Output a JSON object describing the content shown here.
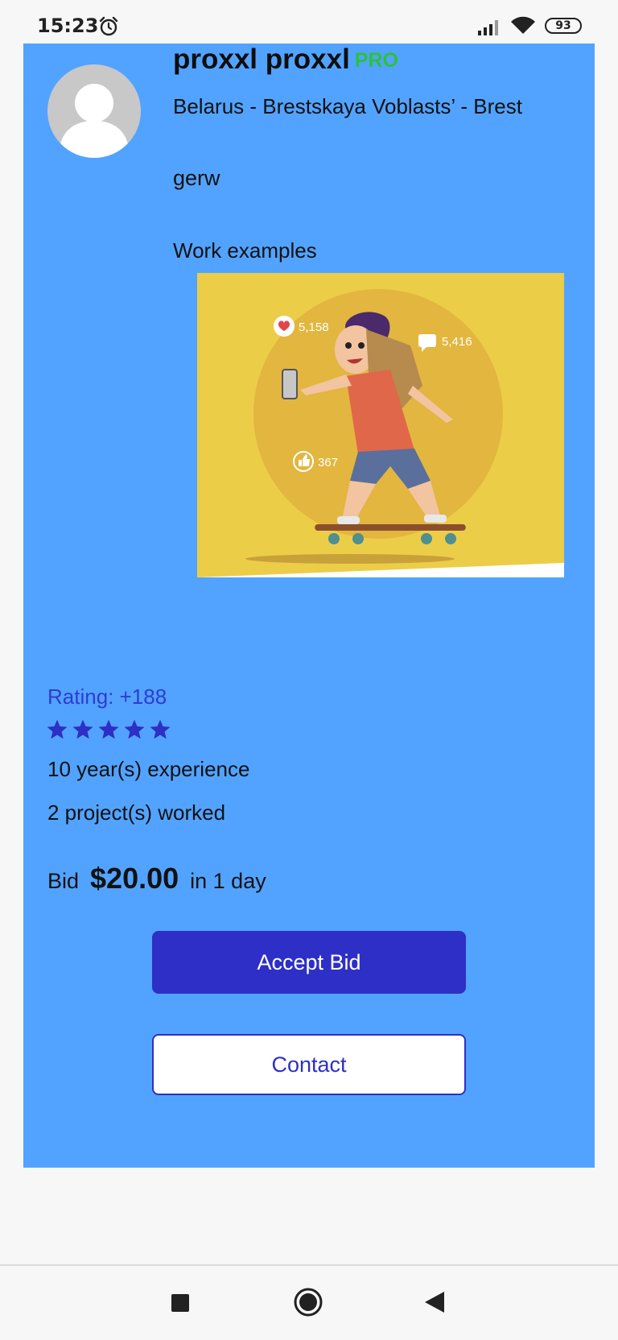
{
  "status_bar": {
    "time": "15:23",
    "battery": "93",
    "icons": [
      "alarm-icon",
      "signal-icon",
      "wifi-icon",
      "battery-icon"
    ]
  },
  "profile": {
    "name": "proxxl proxxl",
    "badge": "PRO",
    "location": "Belarus - Brestskaya Voblasts’ - Brest",
    "description": "gerw",
    "work_examples_label": "Work examples",
    "work_image": {
      "likes": "5,158",
      "comments": "5,416",
      "thumbs": "367"
    }
  },
  "stats": {
    "rating": "Rating: +188",
    "stars": 5,
    "experience": "10 year(s) experience",
    "projects": "2 project(s) worked"
  },
  "bid": {
    "label": "Bid",
    "amount": "$20.00",
    "time": "in 1 day"
  },
  "actions": {
    "accept_label": "Accept Bid",
    "contact_label": "Contact"
  },
  "colors": {
    "card_background": "#52a3ff",
    "accent": "#2d2fc6",
    "pro_badge": "#2bc23a",
    "rating_text": "#2f3bd1"
  },
  "nav_bar": [
    "recent-apps-icon",
    "home-icon",
    "back-icon"
  ]
}
